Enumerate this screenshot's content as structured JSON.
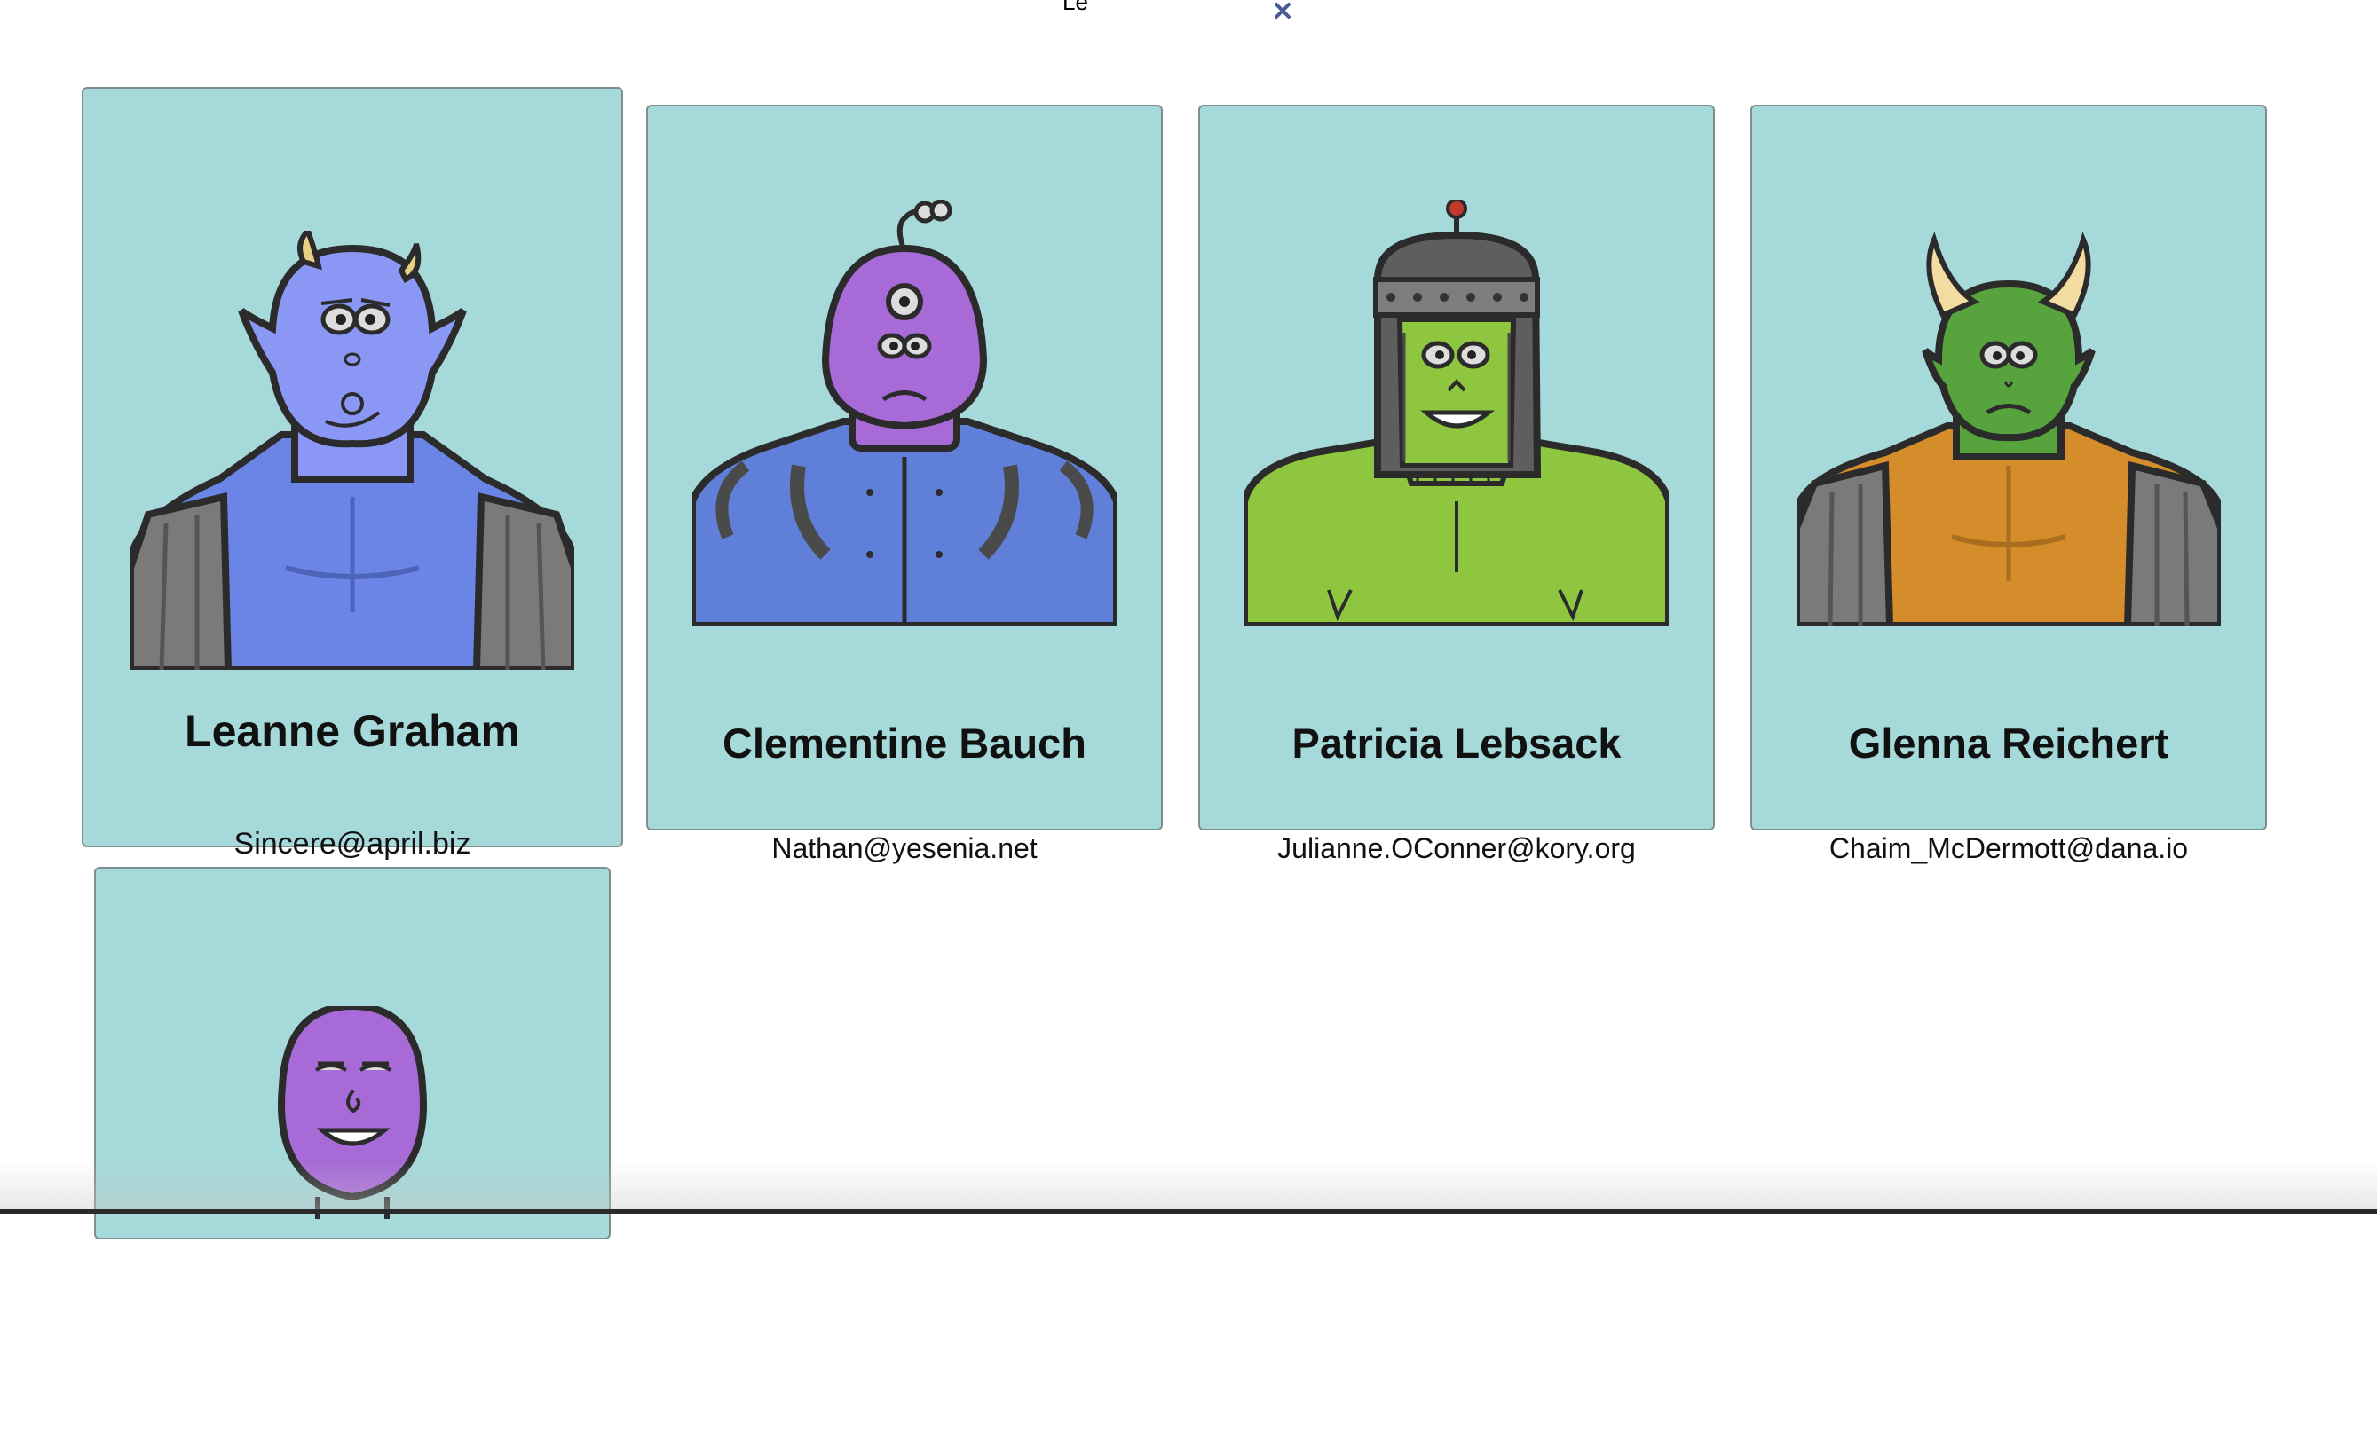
{
  "search": {
    "value": "Le",
    "clear_icon": "close-icon"
  },
  "colors": {
    "card_background": "#a6d9da",
    "card_border": "#7d8f8f",
    "clear_icon": "#4a5a9a"
  },
  "robots": [
    {
      "name": "Leanne Graham",
      "email": "Sincere@april.biz",
      "avatar": "blue-horned-monster-avatar"
    },
    {
      "name": "Clementine Bauch",
      "email": "Nathan@yesenia.net",
      "avatar": "purple-cyclops-robot-avatar"
    },
    {
      "name": "Patricia Lebsack",
      "email": "Julianne.OConner@kory.org",
      "avatar": "green-helmet-robot-avatar"
    },
    {
      "name": "Glenna Reichert",
      "email": "Chaim_McDermott@dana.io",
      "avatar": "green-horned-monster-avatar"
    },
    {
      "name": "",
      "email": "",
      "avatar": "purple-grinning-monster-avatar"
    }
  ]
}
